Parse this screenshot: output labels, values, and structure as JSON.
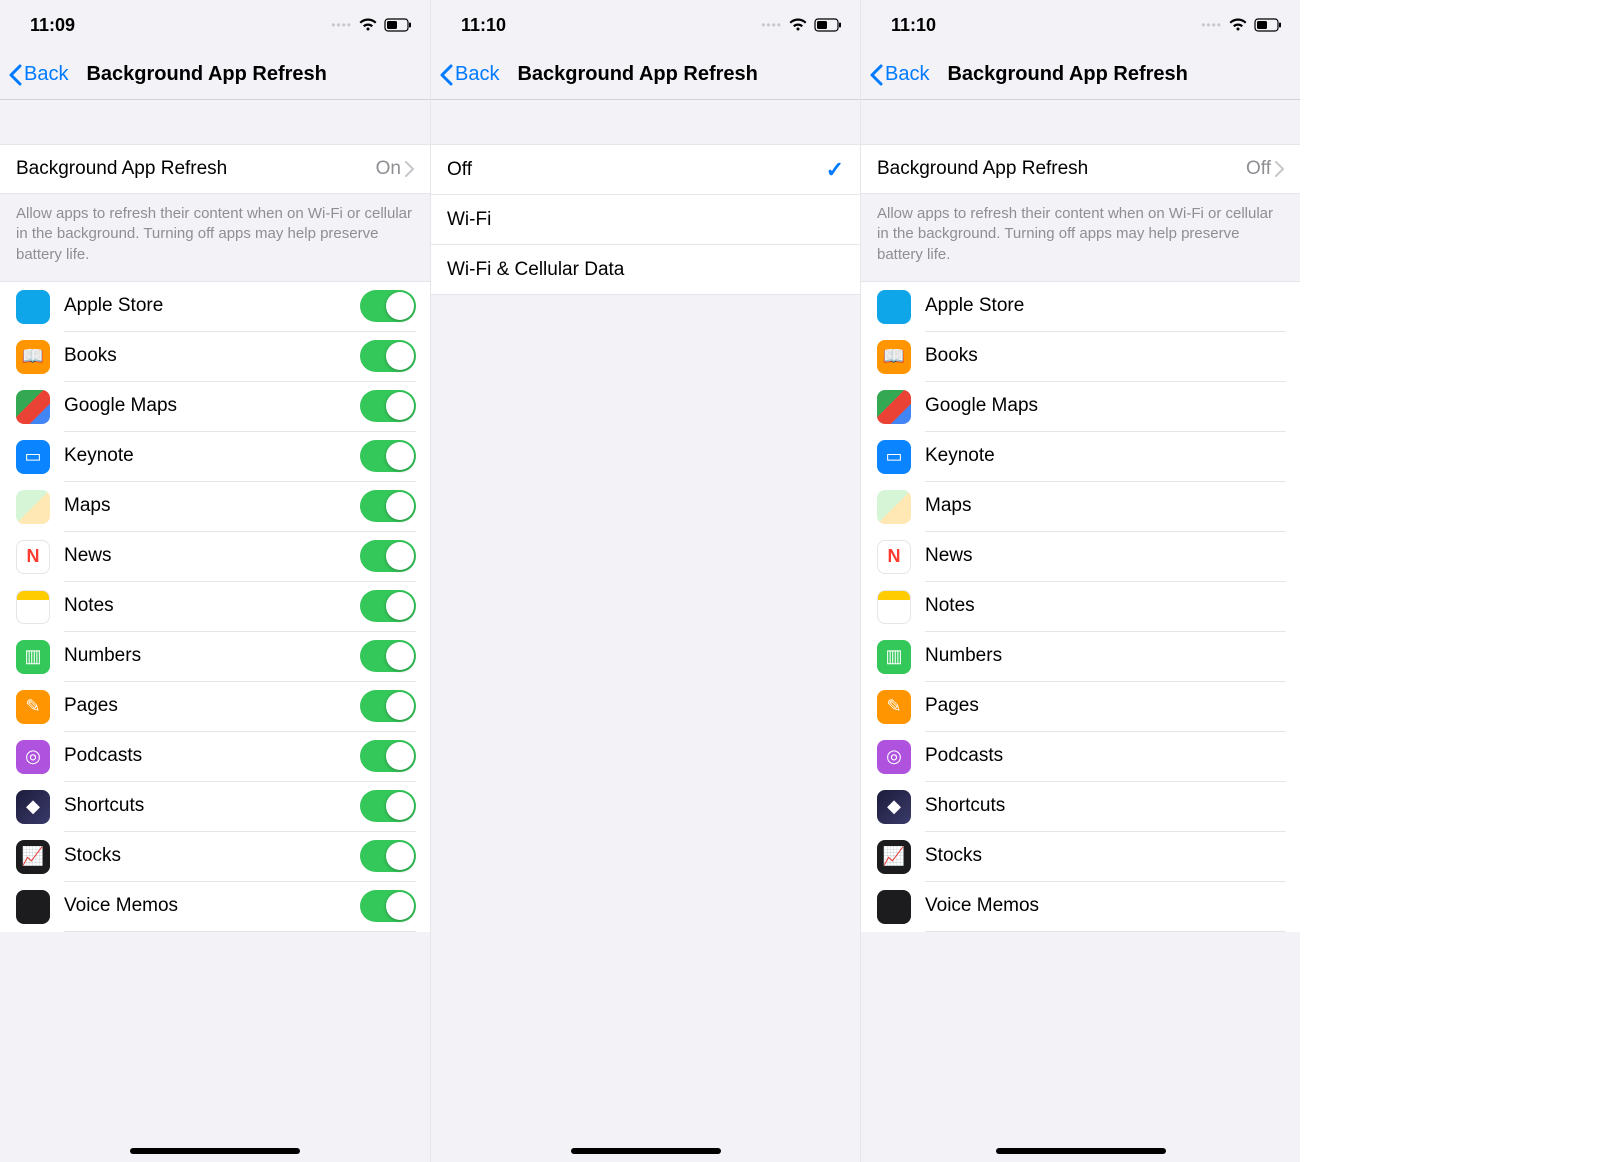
{
  "screens": [
    {
      "status_time": "11:09",
      "back_label": "Back",
      "page_title": "Background App Refresh",
      "bar_label": "Background App Refresh",
      "bar_value": "On",
      "footer": "Allow apps to refresh their content when on Wi-Fi or cellular in the background. Turning off apps may help preserve battery life.",
      "show_toggles": true,
      "home_indicator_width": 170
    },
    {
      "status_time": "11:10",
      "back_label": "Back",
      "page_title": "Background App Refresh",
      "options": [
        "Off",
        "Wi-Fi",
        "Wi-Fi & Cellular Data"
      ],
      "selected_index": 0,
      "home_indicator_width": 150
    },
    {
      "status_time": "11:10",
      "back_label": "Back",
      "page_title": "Background App Refresh",
      "bar_label": "Background App Refresh",
      "bar_value": "Off",
      "footer": "Allow apps to refresh their content when on Wi-Fi or cellular in the background. Turning off apps may help preserve battery life.",
      "show_toggles": false,
      "home_indicator_width": 170
    }
  ],
  "apps": [
    {
      "name": "Apple Store",
      "icon_class": "ic-applestore",
      "glyph": ""
    },
    {
      "name": "Books",
      "icon_class": "ic-books",
      "glyph": "📖"
    },
    {
      "name": "Google Maps",
      "icon_class": "ic-gmaps",
      "glyph": ""
    },
    {
      "name": "Keynote",
      "icon_class": "ic-keynote",
      "glyph": "▭"
    },
    {
      "name": "Maps",
      "icon_class": "ic-maps",
      "glyph": ""
    },
    {
      "name": "News",
      "icon_class": "ic-news",
      "glyph": "N"
    },
    {
      "name": "Notes",
      "icon_class": "ic-notes",
      "glyph": ""
    },
    {
      "name": "Numbers",
      "icon_class": "ic-numbers",
      "glyph": "▥"
    },
    {
      "name": "Pages",
      "icon_class": "ic-pages",
      "glyph": "✎"
    },
    {
      "name": "Podcasts",
      "icon_class": "ic-podcasts",
      "glyph": "◎"
    },
    {
      "name": "Shortcuts",
      "icon_class": "ic-shortcuts",
      "glyph": "◆"
    },
    {
      "name": "Stocks",
      "icon_class": "ic-stocks",
      "glyph": "📈"
    },
    {
      "name": "Voice Memos",
      "icon_class": "ic-voicememos",
      "glyph": ""
    }
  ]
}
